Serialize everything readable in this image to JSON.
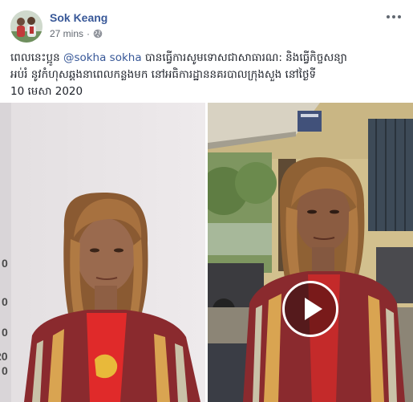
{
  "post": {
    "author": "Sok Keang",
    "timestamp": "27 mins",
    "separator": "·",
    "privacy_icon": "globe-icon",
    "more_icon": "more-options-icon"
  },
  "caption": {
    "line1_before": "ពេលនេះប្អូន ",
    "mention": "@sokha sokha",
    "line1_after": " បានធ្វើការសូមទោសជាសាធារណ: និងធ្វើកិច្ចសន្យា",
    "line2": "អប់រំ នូវកំហុសឆ្គងនាពេលកន្លងមក នៅអធិការដ្ឋាននគរបាលក្រុងសួង នៅថ្ងៃទី",
    "line3": "10 មេសា 2020"
  },
  "media": {
    "left_photo": "photo",
    "right_video": "video",
    "play_icon": "play-icon",
    "scale_marks": [
      "0",
      "0",
      "0",
      "20",
      "0"
    ]
  },
  "colors": {
    "link": "#385898",
    "text": "#1d2129",
    "meta": "#616770"
  }
}
